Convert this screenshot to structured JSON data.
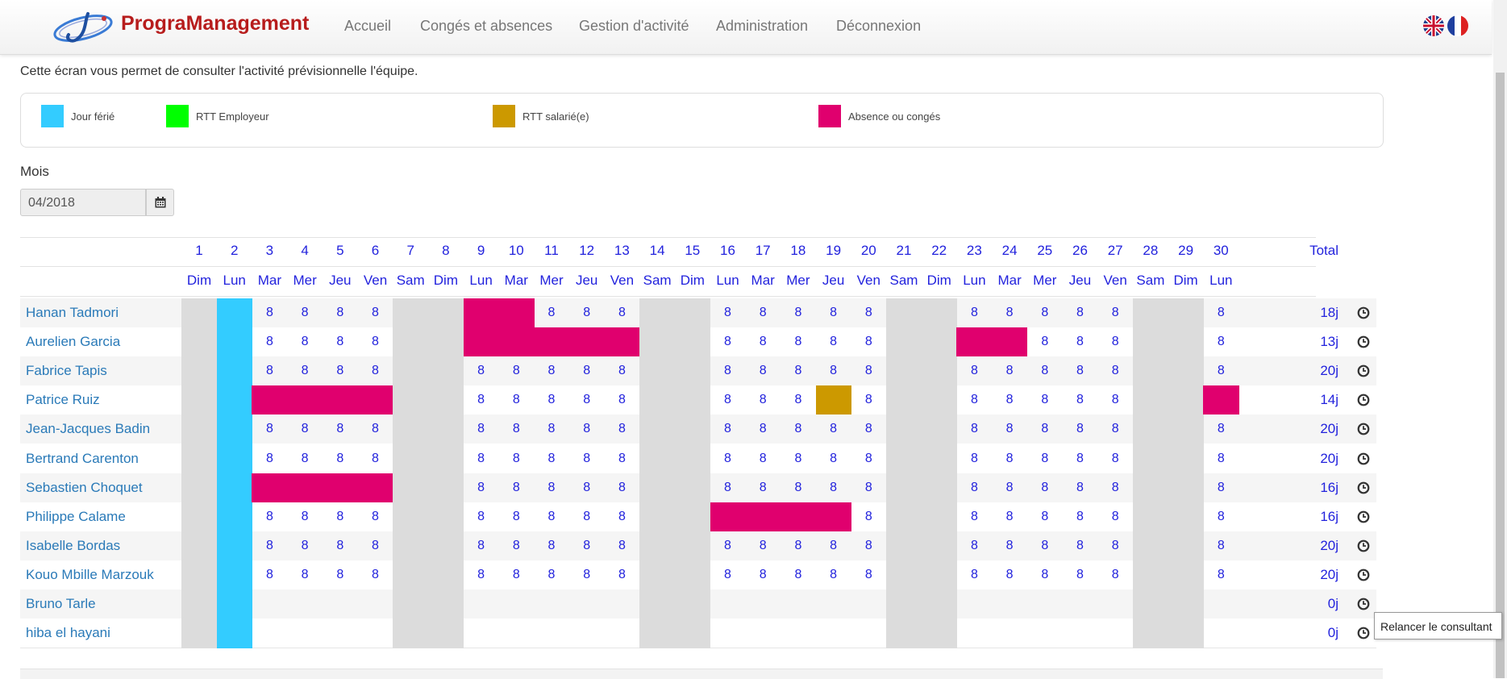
{
  "app": {
    "brand": "PrograManagement",
    "nav": [
      "Accueil",
      "Congés et absences",
      "Gestion d'activité",
      "Administration",
      "Déconnexion"
    ],
    "flags": [
      "uk-flag-icon",
      "fr-flag-icon"
    ]
  },
  "intro": "Cette écran vous permet de consulter l'activité prévisionnelle l'équipe.",
  "legend": [
    {
      "label": "Jour férié",
      "color": "#33ccff"
    },
    {
      "label": "RTT Employeur",
      "color": "#00ff00"
    },
    {
      "label": "RTT salarié(e)",
      "color": "#cc9900"
    },
    {
      "label": "Absence ou congés",
      "color": "#e0006e"
    }
  ],
  "month": {
    "label": "Mois",
    "value": "04/2018"
  },
  "colors": {
    "holiday": "#33ccff",
    "weekend": "#dcdcdc",
    "absence": "#e0006e",
    "rtt_salarie": "#cc9900",
    "link": "#2222dd"
  },
  "table": {
    "days": [
      "1",
      "2",
      "3",
      "4",
      "5",
      "6",
      "7",
      "8",
      "9",
      "10",
      "11",
      "12",
      "13",
      "14",
      "15",
      "16",
      "17",
      "18",
      "19",
      "20",
      "21",
      "22",
      "23",
      "24",
      "25",
      "26",
      "27",
      "28",
      "29",
      "30"
    ],
    "weekdays": [
      "Dim",
      "Lun",
      "Mar",
      "Mer",
      "Jeu",
      "Ven",
      "Sam",
      "Dim",
      "Lun",
      "Mar",
      "Mer",
      "Jeu",
      "Ven",
      "Sam",
      "Dim",
      "Lun",
      "Mar",
      "Mer",
      "Jeu",
      "Ven",
      "Sam",
      "Dim",
      "Lun",
      "Mar",
      "Mer",
      "Jeu",
      "Ven",
      "Sam",
      "Dim",
      "Lun"
    ],
    "total_label": "Total",
    "rows": [
      {
        "name": "Hanan Tadmori",
        "total": "18j",
        "cells": [
          "W",
          "H",
          "8",
          "8",
          "8",
          "8",
          "W",
          "W",
          "A",
          "A",
          "8",
          "8",
          "8",
          "W",
          "W",
          "8",
          "8",
          "8",
          "8",
          "8",
          "W",
          "W",
          "8",
          "8",
          "8",
          "8",
          "8",
          "W",
          "W",
          "8"
        ]
      },
      {
        "name": "Aurelien Garcia",
        "total": "13j",
        "cells": [
          "W",
          "H",
          "8",
          "8",
          "8",
          "8",
          "W",
          "W",
          "A",
          "A",
          "A",
          "A",
          "A",
          "W",
          "W",
          "8",
          "8",
          "8",
          "8",
          "8",
          "W",
          "W",
          "A",
          "A",
          "8",
          "8",
          "8",
          "W",
          "W",
          "8"
        ]
      },
      {
        "name": "Fabrice Tapis",
        "total": "20j",
        "cells": [
          "W",
          "H",
          "8",
          "8",
          "8",
          "8",
          "W",
          "W",
          "8",
          "8",
          "8",
          "8",
          "8",
          "W",
          "W",
          "8",
          "8",
          "8",
          "8",
          "8",
          "W",
          "W",
          "8",
          "8",
          "8",
          "8",
          "8",
          "W",
          "W",
          "8"
        ]
      },
      {
        "name": "Patrice Ruiz",
        "total": "14j",
        "cells": [
          "W",
          "H",
          "A",
          "A",
          "A",
          "A",
          "W",
          "W",
          "8",
          "8",
          "8",
          "8",
          "8",
          "W",
          "W",
          "8",
          "8",
          "8",
          "R",
          "8",
          "W",
          "W",
          "8",
          "8",
          "8",
          "8",
          "8",
          "W",
          "W",
          "A"
        ]
      },
      {
        "name": "Jean-Jacques Badin",
        "total": "20j",
        "cells": [
          "W",
          "H",
          "8",
          "8",
          "8",
          "8",
          "W",
          "W",
          "8",
          "8",
          "8",
          "8",
          "8",
          "W",
          "W",
          "8",
          "8",
          "8",
          "8",
          "8",
          "W",
          "W",
          "8",
          "8",
          "8",
          "8",
          "8",
          "W",
          "W",
          "8"
        ]
      },
      {
        "name": "Bertrand Carenton",
        "total": "20j",
        "cells": [
          "W",
          "H",
          "8",
          "8",
          "8",
          "8",
          "W",
          "W",
          "8",
          "8",
          "8",
          "8",
          "8",
          "W",
          "W",
          "8",
          "8",
          "8",
          "8",
          "8",
          "W",
          "W",
          "8",
          "8",
          "8",
          "8",
          "8",
          "W",
          "W",
          "8"
        ]
      },
      {
        "name": "Sebastien Choquet",
        "total": "16j",
        "cells": [
          "W",
          "H",
          "A",
          "A",
          "A",
          "A",
          "W",
          "W",
          "8",
          "8",
          "8",
          "8",
          "8",
          "W",
          "W",
          "8",
          "8",
          "8",
          "8",
          "8",
          "W",
          "W",
          "8",
          "8",
          "8",
          "8",
          "8",
          "W",
          "W",
          "8"
        ]
      },
      {
        "name": "Philippe Calame",
        "total": "16j",
        "cells": [
          "W",
          "H",
          "8",
          "8",
          "8",
          "8",
          "W",
          "W",
          "8",
          "8",
          "8",
          "8",
          "8",
          "W",
          "W",
          "A",
          "A",
          "A",
          "A",
          "8",
          "W",
          "W",
          "8",
          "8",
          "8",
          "8",
          "8",
          "W",
          "W",
          "8"
        ]
      },
      {
        "name": "Isabelle Bordas",
        "total": "20j",
        "cells": [
          "W",
          "H",
          "8",
          "8",
          "8",
          "8",
          "W",
          "W",
          "8",
          "8",
          "8",
          "8",
          "8",
          "W",
          "W",
          "8",
          "8",
          "8",
          "8",
          "8",
          "W",
          "W",
          "8",
          "8",
          "8",
          "8",
          "8",
          "W",
          "W",
          "8"
        ]
      },
      {
        "name": "Kouo Mbille Marzouk",
        "total": "20j",
        "cells": [
          "W",
          "H",
          "8",
          "8",
          "8",
          "8",
          "W",
          "W",
          "8",
          "8",
          "8",
          "8",
          "8",
          "W",
          "W",
          "8",
          "8",
          "8",
          "8",
          "8",
          "W",
          "W",
          "8",
          "8",
          "8",
          "8",
          "8",
          "W",
          "W",
          "8"
        ]
      },
      {
        "name": "Bruno Tarle",
        "total": "0j",
        "cells": [
          "W",
          "H",
          "",
          "",
          "",
          "",
          "W",
          "W",
          "",
          "",
          "",
          "",
          "",
          "W",
          "W",
          "",
          "",
          "",
          "",
          "",
          "W",
          "W",
          "",
          "",
          "",
          "",
          "",
          "W",
          "W",
          ""
        ]
      },
      {
        "name": "hiba el hayani",
        "total": "0j",
        "cells": [
          "W",
          "H",
          "",
          "",
          "",
          "",
          "W",
          "W",
          "",
          "",
          "",
          "",
          "",
          "W",
          "W",
          "",
          "",
          "",
          "",
          "",
          "W",
          "W",
          "",
          "",
          "",
          "",
          "",
          "W",
          "W",
          ""
        ]
      }
    ]
  },
  "tooltip": "Relancer le consultant"
}
